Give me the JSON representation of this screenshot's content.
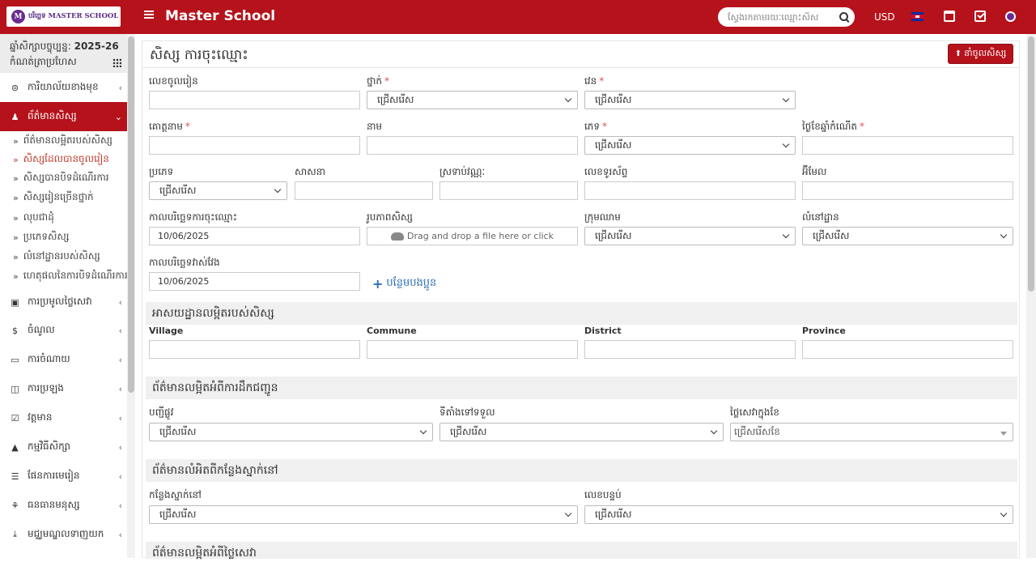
{
  "app": {
    "logo_text": "បរិច្ឆេទ MASTER SCHOOL",
    "logo_mark": "M",
    "title": "Master School",
    "menu_icon": "hamburger-icon"
  },
  "header": {
    "search_placeholder": "ស្វែងរកតាមរយៈឈ្មោះសិស",
    "search_icon": "search-icon",
    "currency": "USD",
    "icons": [
      "cambodia-flag-icon",
      "calendar-icon",
      "checkbox-icon",
      "school-emblem-icon"
    ]
  },
  "sidebar": {
    "year_label": "ឆ្នាំសិក្សាបច្ចុប្បន្ន:",
    "year_value": "2025-26",
    "attendance_label": "កំណត់ត្រាប្រហែស",
    "items": [
      {
        "label": "ការិយាល័យខាងមុខ",
        "icon": "front-office-icon"
      },
      {
        "label": "ព័ត៌មានសិស្ស",
        "icon": "student-info-icon",
        "active": true
      },
      {
        "label": "ការប្រមូលថ្លៃសេវា",
        "icon": "fees-icon"
      },
      {
        "label": "ចំណូល",
        "icon": "dollar-icon"
      },
      {
        "label": "ការចំណាយ",
        "icon": "credit-card-icon"
      },
      {
        "label": "ការប្រឡង",
        "icon": "map-icon"
      },
      {
        "label": "វត្តមាន",
        "icon": "calendar-check-icon"
      },
      {
        "label": "កម្មវិធីសិក្សា",
        "icon": "graduation-cap-icon"
      },
      {
        "label": "ផែនការមេរៀន",
        "icon": "list-icon"
      },
      {
        "label": "ធនធានមនុស្ស",
        "icon": "sitemap-icon"
      },
      {
        "label": "មជ្ឈមណ្ឌលទាញយក",
        "icon": "download-icon"
      }
    ],
    "subitems": [
      "ព័ត៌មានលម្អិតរបស់សិស្ស",
      "សិស្សដែលបានចូលរៀន",
      "សិស្សបានបិទដំណើរការ",
      "សិស្សរៀនច្រើនថ្នាក់",
      "លុបជាដុំ",
      "ប្រភេទសិស្ស",
      "លំនៅដ្ឋានរបស់សិស្ស",
      "ហេតុផលនៃការបិទដំណើរការ"
    ]
  },
  "page": {
    "title": "សិស្ស ការចុះឈ្មោះ",
    "import_button": "នាំចូលសិស្ស",
    "fields": {
      "admission_no": {
        "label": "លេខចូលរៀន",
        "value": ""
      },
      "class": {
        "label": "ថ្នាក់",
        "value": "ជ្រើសរើស"
      },
      "section": {
        "label": "វេន",
        "value": "ជ្រើសរើស"
      },
      "last_name": {
        "label": "គោត្តនាម",
        "value": ""
      },
      "first_name": {
        "label": "នាម",
        "value": ""
      },
      "gender": {
        "label": "ភេទ",
        "value": "ជ្រើសរើស"
      },
      "dob": {
        "label": "ថ្ងៃខែឆ្នាំកំណើត",
        "value": ""
      },
      "category": {
        "label": "ប្រភេទ",
        "value": "ជ្រើសរើស"
      },
      "religion": {
        "label": "សាសនា",
        "value": ""
      },
      "caste": {
        "label": "ស្រទាប់វណ្ណៈ",
        "value": ""
      },
      "mobile": {
        "label": "លេខទូរស័ព្ទ",
        "value": ""
      },
      "email": {
        "label": "អ៊ីមែល",
        "value": ""
      },
      "admission_date": {
        "label": "កាលបរិច្ឆេទការចុះឈ្មោះ",
        "value": "10/06/2025"
      },
      "photo": {
        "label": "រូបភាពសិស្ស",
        "placeholder": "Drag and drop a file here or click"
      },
      "blood_group": {
        "label": "ក្រុមឈាម",
        "value": "ជ្រើសរើស"
      },
      "house": {
        "label": "លំនៅដ្ឋាន",
        "value": "ជ្រើសរើស"
      },
      "as_on_date": {
        "label": "កាលបរិច្ឆេទវាស់វែង",
        "value": "10/06/2025"
      }
    },
    "add_sibling": "បន្ថែមបងប្អូន",
    "address_section": {
      "title": "អាសយដ្ឋានលម្អិតរបស់សិស្ស",
      "village": "Village",
      "commune": "Commune",
      "district": "District",
      "province": "Province"
    },
    "transport_section": {
      "title": "ព័ត៌មានលម្អិតអំពីការដឹកជញ្ជូន",
      "route_label": "បញ្ជីផ្លូវ",
      "route_value": "ជ្រើសរើស",
      "pickup_label": "ទីតាំងទៅទទួល",
      "pickup_value": "ជ្រើសរើស",
      "fees_month_label": "ថ្លៃសេវាក្នុងខែ",
      "fees_month_value": "ជ្រើសរើសខែ"
    },
    "hostel_section": {
      "title": "ព័ត៌មានលំអិតពីកន្លែងស្នាក់នៅ",
      "hostel_label": "កន្លែងស្នាក់នៅ",
      "hostel_value": "ជ្រើសរើស",
      "room_label": "លេខបន្ទប់",
      "room_value": "ជ្រើសរើស"
    },
    "fees_section": {
      "title": "ព័ត៌មានលម្អិតអំពីថ្លៃសេវា"
    }
  }
}
